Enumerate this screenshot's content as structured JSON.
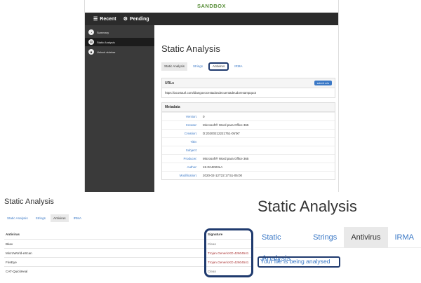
{
  "app": {
    "brand": "SANDBOX",
    "nav": [
      {
        "icon": "list-icon",
        "label": "Recent"
      },
      {
        "icon": "gears-icon",
        "label": "Pending"
      }
    ],
    "sidebar": [
      {
        "icon": "dashboard-icon",
        "label": "Summary",
        "active": false
      },
      {
        "icon": "document-icon",
        "label": "Static Analysis",
        "active": true
      },
      {
        "icon": "lock-icon",
        "label": "Unlock sidebar",
        "active": false
      }
    ]
  },
  "top_panel": {
    "title": "Static Analysis",
    "tabs": [
      "Static Analysis",
      "Strings",
      "Antivirus",
      "IRMA"
    ],
    "urls_header": "URLs",
    "submit_label": "submit urls",
    "url": "https://acortaurl.com/diangovocestadosdecuentadeudoresampquot",
    "metadata_header": "Metadata",
    "metadata": [
      {
        "key": "Version:",
        "value": "0"
      },
      {
        "key": "Creator:",
        "value": "Microsoft® Word para Office 365"
      },
      {
        "key": "Creation:",
        "value": "D:20200212221751-05'00'"
      },
      {
        "key": "Title:",
        "value": ""
      },
      {
        "key": "Subject:",
        "value": ""
      },
      {
        "key": "Producer:",
        "value": "Microsoft® Word para Office 365"
      },
      {
        "key": "Author:",
        "value": "15-DA0023LA"
      },
      {
        "key": "Modification:",
        "value": "2020-02-12T22:17:51-05:00"
      }
    ]
  },
  "bottom_left": {
    "title": "Static Analysis",
    "tabs": [
      "Static Analysis",
      "Strings",
      "Antivirus",
      "IRMA"
    ],
    "columns": [
      "Antivirus",
      "Signature"
    ],
    "rows": [
      {
        "av": "Bkav",
        "signature": "Clean",
        "malicious": false
      },
      {
        "av": "MicroWorld-eScan",
        "signature": "Trojan.GenericKD.42604541",
        "malicious": true
      },
      {
        "av": "FireEye",
        "signature": "Trojan.GenericKD.42604541",
        "malicious": true
      },
      {
        "av": "CAT-QuickHeal",
        "signature": "Clean",
        "malicious": false
      }
    ]
  },
  "bottom_right": {
    "title": "Static Analysis",
    "tabs": [
      "Static Analysis",
      "Strings",
      "Antivirus",
      "IRMA"
    ],
    "status": "Your file is being analysed"
  }
}
